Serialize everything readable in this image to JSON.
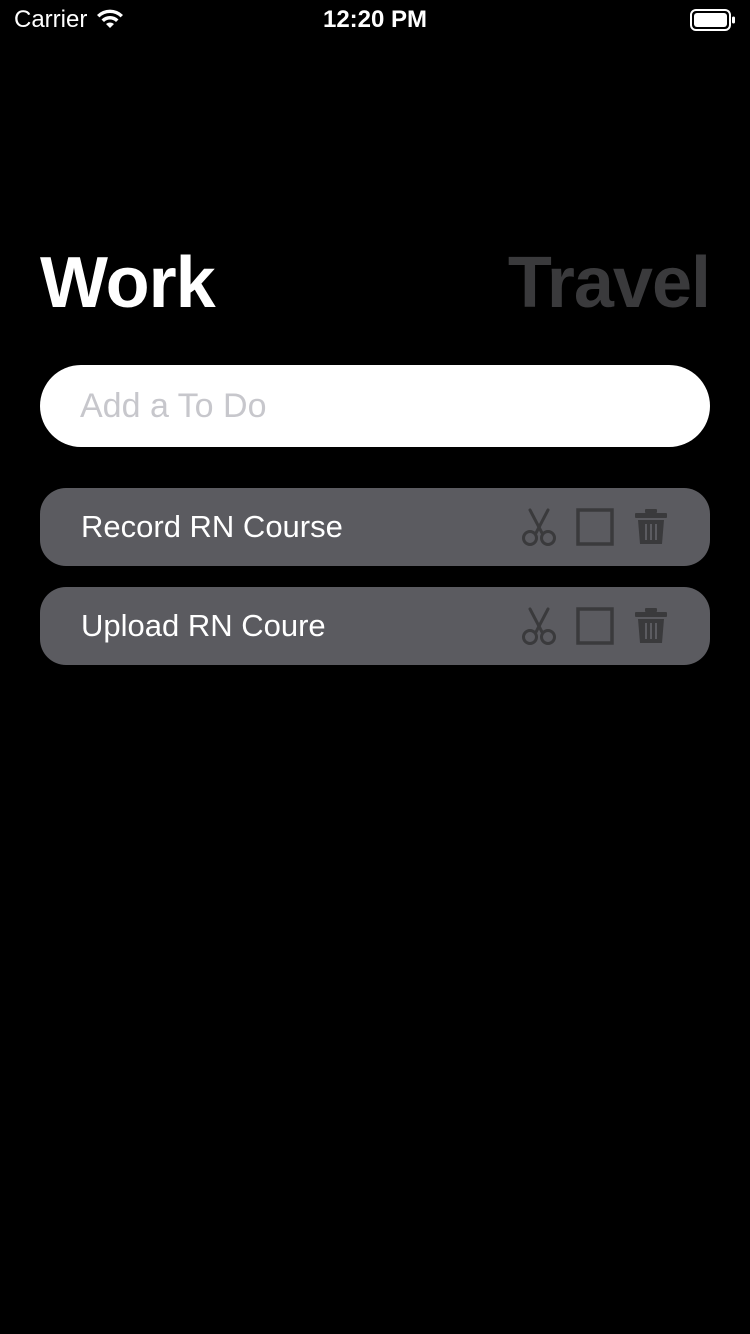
{
  "status_bar": {
    "carrier": "Carrier",
    "time": "12:20 PM"
  },
  "tabs": [
    {
      "label": "Work",
      "active": true
    },
    {
      "label": "Travel",
      "active": false
    }
  ],
  "input": {
    "placeholder": "Add a To Do",
    "value": ""
  },
  "todos": [
    {
      "text": "Record RN Course",
      "icons": [
        "scissors-icon",
        "checkbox-icon",
        "trash-icon"
      ]
    },
    {
      "text": "Upload RN Coure",
      "icons": [
        "scissors-icon",
        "checkbox-icon",
        "trash-icon"
      ]
    }
  ],
  "colors": {
    "background": "#000000",
    "item_background": "#5b5b60",
    "inactive_tab": "#3a3a3c",
    "icon": "#3a3a3c",
    "input_background": "#ffffff",
    "placeholder": "#c7c7cc"
  }
}
